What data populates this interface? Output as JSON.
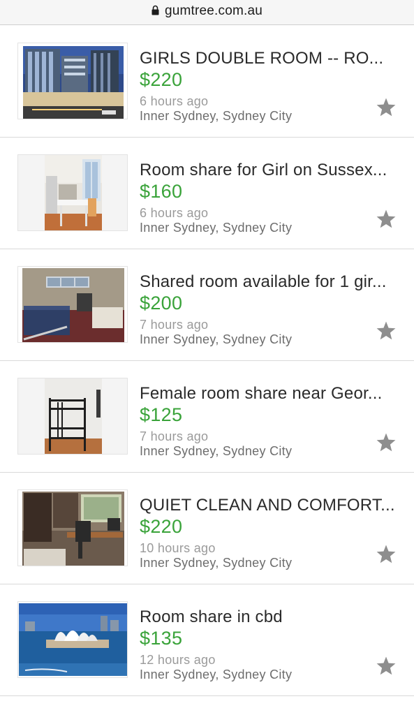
{
  "browser": {
    "url": "gumtree.com.au"
  },
  "listings": [
    {
      "title": "GIRLS DOUBLE ROOM -- RO...",
      "price": "$220",
      "time": "6 hours ago",
      "location": "Inner Sydney, Sydney City",
      "thumbnail": "city-building-photo"
    },
    {
      "title": "Room share for Girl on Sussex...",
      "price": "$160",
      "time": "6 hours ago",
      "location": "Inner Sydney, Sydney City",
      "thumbnail": "kitchen-room-photo"
    },
    {
      "title": "Shared room available for 1 gir...",
      "price": "$200",
      "time": "7 hours ago",
      "location": "Inner Sydney, Sydney City",
      "thumbnail": "bedroom-photo"
    },
    {
      "title": "Female room share near Geor...",
      "price": "$125",
      "time": "7 hours ago",
      "location": "Inner Sydney, Sydney City",
      "thumbnail": "bunk-bed-photo"
    },
    {
      "title": "QUIET CLEAN AND COMFORT...",
      "price": "$220",
      "time": "10 hours ago",
      "location": "Inner Sydney, Sydney City",
      "thumbnail": "study-room-photo"
    },
    {
      "title": "Room share in cbd",
      "price": "$135",
      "time": "12 hours ago",
      "location": "Inner Sydney, Sydney City",
      "thumbnail": "opera-house-photo"
    }
  ],
  "colors": {
    "price": "#3aa33a",
    "star": "#8e8e8e"
  },
  "icons": {
    "favorite": "star-icon",
    "secure": "lock-icon"
  }
}
